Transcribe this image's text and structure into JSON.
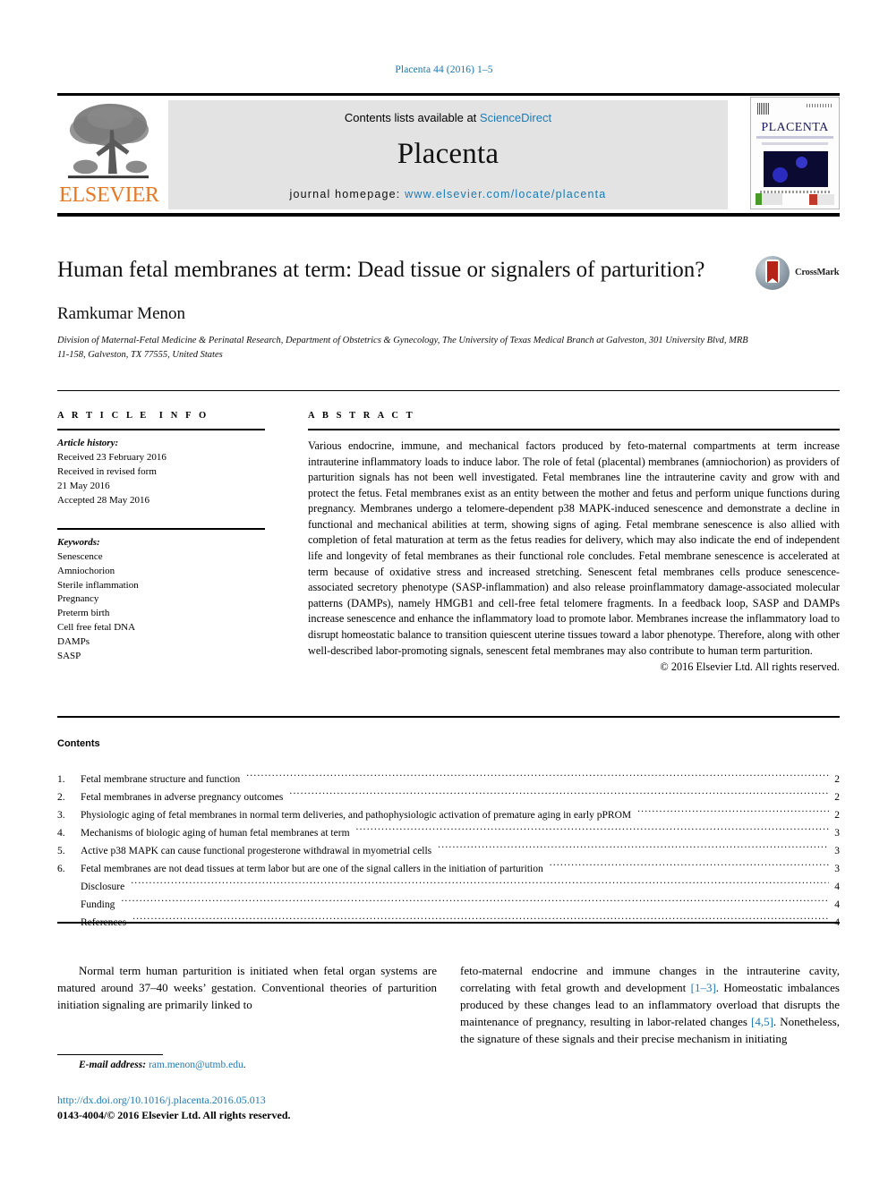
{
  "running_head": "Placenta 44 (2016) 1–5",
  "masthead": {
    "publisher_logo_text": "ELSEVIER",
    "contents_prefix": "Contents lists available at ",
    "contents_link": "ScienceDirect",
    "journal_title": "Placenta",
    "homepage_prefix": "journal homepage: ",
    "homepage_url": "www.elsevier.com/locate/placenta",
    "cover_title": "PLACENTA",
    "link_color": "#1a7bb9",
    "band_color": "#e3e3e3",
    "elsevier_orange": "#e87722"
  },
  "article": {
    "title": "Human fetal membranes at term: Dead tissue or signalers of parturition?",
    "author": "Ramkumar Menon",
    "affiliation": "Division of Maternal-Fetal Medicine & Perinatal Research, Department of Obstetrics & Gynecology, The University of Texas Medical Branch at Galveston, 301 University Blvd, MRB 11-158, Galveston, TX 77555, United States",
    "crossmark_label": "CrossMark"
  },
  "article_info": {
    "heading": "ARTICLE INFO",
    "history_label": "Article history:",
    "history": [
      "Received 23 February 2016",
      "Received in revised form",
      "21 May 2016",
      "Accepted 28 May 2016"
    ],
    "keywords_label": "Keywords:",
    "keywords": [
      "Senescence",
      "Amniochorion",
      "Sterile inflammation",
      "Pregnancy",
      "Preterm birth",
      "Cell free fetal DNA",
      "DAMPs",
      "SASP"
    ]
  },
  "abstract": {
    "heading": "ABSTRACT",
    "text": "Various endocrine, immune, and mechanical factors produced by feto-maternal compartments at term increase intrauterine inflammatory loads to induce labor. The role of fetal (placental) membranes (amniochorion) as providers of parturition signals has not been well investigated. Fetal membranes line the intrauterine cavity and grow with and protect the fetus. Fetal membranes exist as an entity between the mother and fetus and perform unique functions during pregnancy. Membranes undergo a telomere-dependent p38 MAPK-induced senescence and demonstrate a decline in functional and mechanical abilities at term, showing signs of aging. Fetal membrane senescence is also allied with completion of fetal maturation at term as the fetus readies for delivery, which may also indicate the end of independent life and longevity of fetal membranes as their functional role concludes. Fetal membrane senescence is accelerated at term because of oxidative stress and increased stretching. Senescent fetal membranes cells produce senescence-associated secretory phenotype (SASP-inflammation) and also release proinflammatory damage-associated molecular patterns (DAMPs), namely HMGB1 and cell-free fetal telomere fragments. In a feedback loop, SASP and DAMPs increase senescence and enhance the inflammatory load to promote labor. Membranes increase the inflammatory load to disrupt homeostatic balance to transition quiescent uterine tissues toward a labor phenotype. Therefore, along with other well-described labor-promoting signals, senescent fetal membranes may also contribute to human term parturition.",
    "copyright": "© 2016 Elsevier Ltd. All rights reserved."
  },
  "contents": {
    "heading": "Contents",
    "entries": [
      {
        "num": "1.",
        "label": "Fetal membrane structure and function",
        "page": "2"
      },
      {
        "num": "2.",
        "label": "Fetal membranes in adverse pregnancy outcomes",
        "page": "2"
      },
      {
        "num": "3.",
        "label": "Physiologic aging of fetal membranes in normal term deliveries, and pathophysiologic activation of premature aging in early pPROM",
        "page": "2"
      },
      {
        "num": "4.",
        "label": "Mechanisms of biologic aging of human fetal membranes at term",
        "page": "3"
      },
      {
        "num": "5.",
        "label": "Active p38 MAPK can cause functional progesterone withdrawal in myometrial cells",
        "page": "3"
      },
      {
        "num": "6.",
        "label": "Fetal membranes are not dead tissues at term labor but are one of the signal callers in the initiation of parturition",
        "page": "3"
      },
      {
        "num": "",
        "label": "Disclosure",
        "page": "4"
      },
      {
        "num": "",
        "label": "Funding",
        "page": "4"
      },
      {
        "num": "",
        "label": "References",
        "page": "4"
      }
    ]
  },
  "body": {
    "left_paragraph": "Normal term human parturition is initiated when fetal organ systems are matured around 37–40 weeks’ gestation. Conventional theories of parturition initiation signaling are primarily linked to",
    "right_part1": "feto-maternal endocrine and immune changes in the intrauterine cavity, correlating with fetal growth and development ",
    "right_cite1": "[1–3]",
    "right_part2": ". Homeostatic imbalances produced by these changes lead to an inflammatory overload that disrupts the maintenance of pregnancy, resulting in labor-related changes ",
    "right_cite2": "[4,5]",
    "right_part3": ". Nonetheless, the signature of these signals and their precise mechanism in initiating"
  },
  "footer": {
    "email_label": "E-mail address:",
    "email": "ram.menon@utmb.edu",
    "email_suffix": ".",
    "doi": "http://dx.doi.org/10.1016/j.placenta.2016.05.013",
    "issn": "0143-4004/© 2016 Elsevier Ltd. All rights reserved."
  }
}
